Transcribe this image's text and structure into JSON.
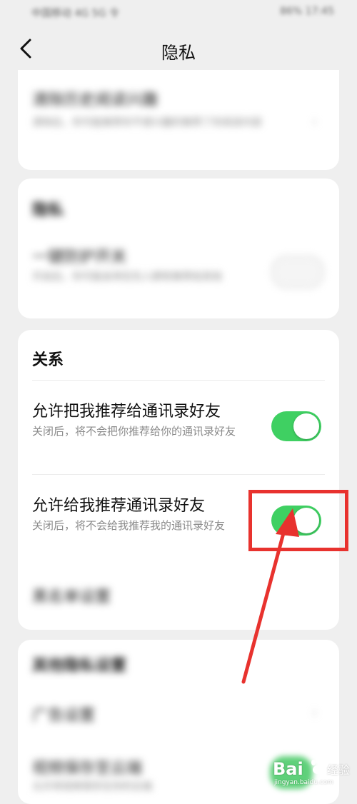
{
  "status_bar": {
    "carrier": "中国移动  4G  5G  令",
    "right": "86%  17:45"
  },
  "header": {
    "back_icon": "chevron-left-icon",
    "title": "隐私"
  },
  "blurred_card_1": {
    "title": "清除历史阅读兴趣",
    "subtitle": "清除后，你可能推荐你不感兴趣的推荐了你阅读内容",
    "chevron": "›"
  },
  "blurred_card_2": {
    "section": "隐私",
    "item_title": "一键防护开关",
    "item_subtitle": "开启后，你可能会将优先人群和推荐给其他"
  },
  "relationship": {
    "section_title": "关系",
    "items": [
      {
        "title": "允许把我推荐给通讯录好友",
        "description": "关闭后，将不会把你推荐给你的通讯录好友",
        "enabled": true
      },
      {
        "title": "允许给我推荐通讯录好友",
        "description": "关闭后，将不会给我推荐我的通讯录好友",
        "enabled": true
      }
    ],
    "blurred_footer": "黑名单设置"
  },
  "blurred_card_3": {
    "section": "其他隐私设置",
    "item_1": "广告设置",
    "item_2": "视频保存至云端",
    "item_2_sub": "允许将视频保存在你的云端"
  },
  "annotation": {
    "highlight_color": "#e8322e"
  },
  "watermark": {
    "brand": "Bai",
    "suffix": "经验",
    "url": "jingyan.baidu.com"
  },
  "colors": {
    "toggle_on": "#3fd062",
    "background": "#efefef",
    "card": "#ffffff"
  }
}
